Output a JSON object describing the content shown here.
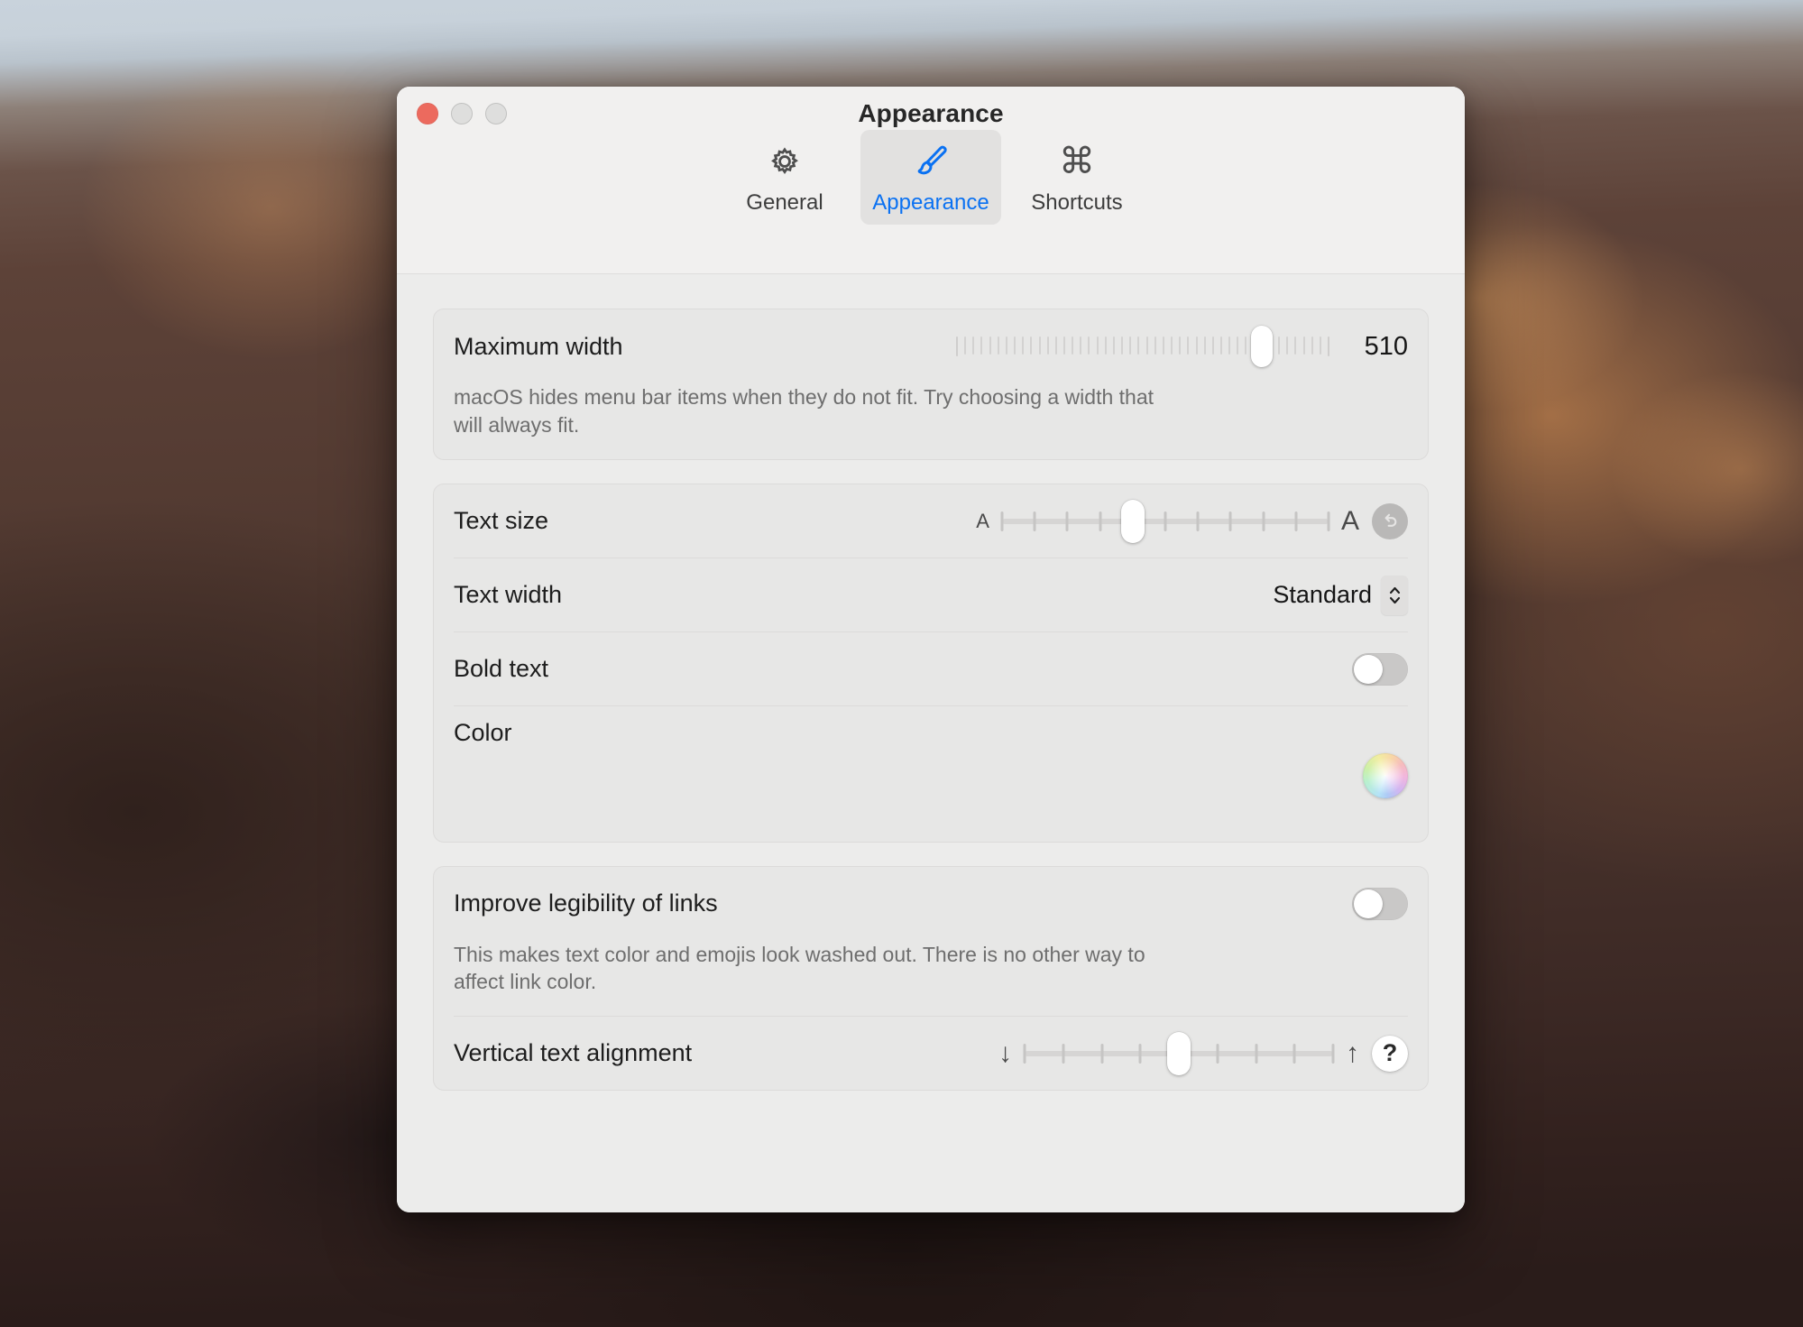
{
  "window": {
    "title": "Appearance",
    "traffic_lights": [
      "close",
      "minimize",
      "zoom"
    ],
    "accent_color": "#0a71f2",
    "close_color": "#ec6a5e"
  },
  "toolbar": {
    "items": [
      {
        "label": "General",
        "icon": "gear-icon",
        "selected": false
      },
      {
        "label": "Appearance",
        "icon": "paintbrush-icon",
        "selected": true
      },
      {
        "label": "Shortcuts",
        "icon": "command-icon",
        "selected": false
      }
    ]
  },
  "sections": {
    "maximum_width": {
      "label": "Maximum width",
      "value": "510",
      "slider": {
        "min": 0,
        "max": 100,
        "value": 82,
        "ticks": 46,
        "style": "dense"
      },
      "description": "macOS hides menu bar items when they do not fit. Try choosing a width that will always fit."
    },
    "text_size": {
      "label": "Text size",
      "cap_left": "A",
      "cap_right": "A",
      "slider": {
        "min": 0,
        "max": 10,
        "value": 4,
        "ticks": 11
      },
      "reset_icon": "reset-arrow-icon"
    },
    "text_width": {
      "label": "Text width",
      "value": "Standard",
      "options": [
        "Standard"
      ],
      "chevron_icon": "chevron-up-down-icon"
    },
    "bold_text": {
      "label": "Bold text",
      "enabled": false
    },
    "color": {
      "label": "Color",
      "swatch_icon": "color-wheel-icon"
    },
    "improve_legibility": {
      "label": "Improve legibility of links",
      "enabled": false,
      "description": "This makes text color and emojis look washed out. There is no other way to affect link color."
    },
    "vertical_text_alignment": {
      "label": "Vertical text alignment",
      "cap_left": "↓",
      "cap_right": "↑",
      "slider": {
        "min": 0,
        "max": 8,
        "value": 4,
        "ticks": 9
      },
      "help_label": "?"
    }
  }
}
